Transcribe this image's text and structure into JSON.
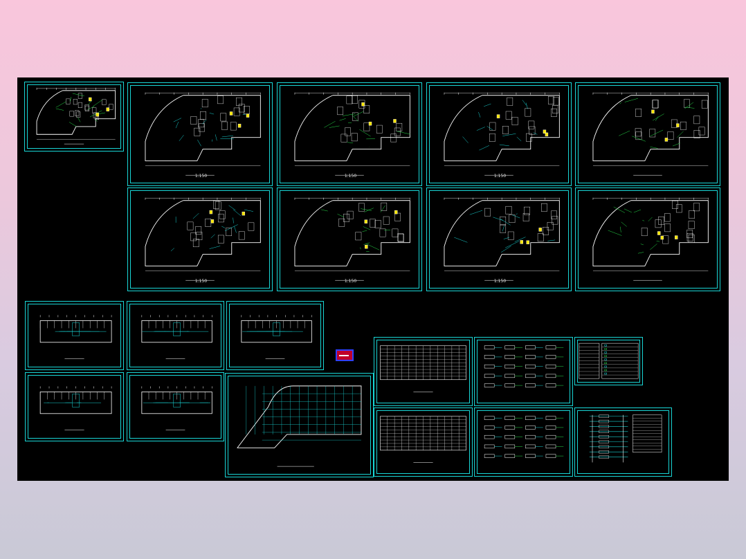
{
  "viewer": {
    "background_top": "#f9c6dc",
    "background_bottom": "#c9c9d6",
    "canvas_color": "#000000",
    "frame_color": "#19d7d7"
  },
  "sheets": [
    {
      "id": "s1",
      "kind": "plan-small",
      "caption": "",
      "scale": ""
    },
    {
      "id": "s2",
      "kind": "plan-curved",
      "caption": "",
      "scale": "1:150"
    },
    {
      "id": "s3",
      "kind": "plan-curved",
      "caption": "",
      "scale": "1:150"
    },
    {
      "id": "s4",
      "kind": "plan-curved",
      "caption": "",
      "scale": "1:150"
    },
    {
      "id": "s5",
      "kind": "plan-curved",
      "caption": "",
      "scale": ""
    },
    {
      "id": "s6",
      "kind": "plan-curved",
      "caption": "",
      "scale": "1:150"
    },
    {
      "id": "s7",
      "kind": "plan-curved",
      "caption": "",
      "scale": "1:150"
    },
    {
      "id": "s8",
      "kind": "plan-curved",
      "caption": "",
      "scale": "1:150"
    },
    {
      "id": "s9",
      "kind": "plan-curved",
      "caption": "",
      "scale": ""
    },
    {
      "id": "s10",
      "kind": "plan-rect",
      "caption": "",
      "scale": ""
    },
    {
      "id": "s11",
      "kind": "plan-rect",
      "caption": "",
      "scale": ""
    },
    {
      "id": "s12",
      "kind": "plan-rect",
      "caption": "",
      "scale": ""
    },
    {
      "id": "s13",
      "kind": "plan-rect",
      "caption": "",
      "scale": ""
    },
    {
      "id": "s14",
      "kind": "plan-rect",
      "caption": "",
      "scale": ""
    },
    {
      "id": "s15",
      "kind": "grid-plan",
      "caption": "",
      "scale": ""
    },
    {
      "id": "s16",
      "kind": "table",
      "caption": "",
      "scale": ""
    },
    {
      "id": "s17",
      "kind": "schematic",
      "caption": "",
      "scale": ""
    },
    {
      "id": "s18",
      "kind": "legend",
      "caption": "",
      "scale": ""
    },
    {
      "id": "s19",
      "kind": "table",
      "caption": "",
      "scale": ""
    },
    {
      "id": "s20",
      "kind": "schematic",
      "caption": "",
      "scale": ""
    },
    {
      "id": "s21",
      "kind": "riser",
      "caption": "",
      "scale": ""
    }
  ]
}
